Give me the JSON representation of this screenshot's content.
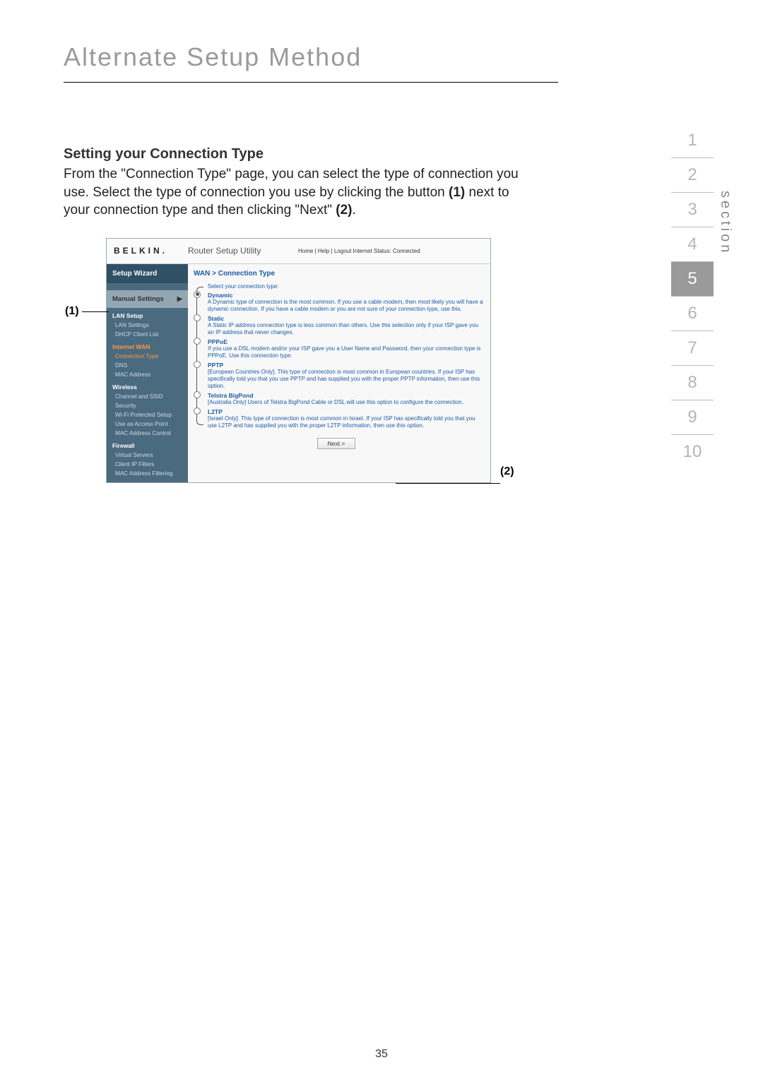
{
  "page_title": "Alternate Setup Method",
  "section_heading": "Setting your Connection Type",
  "body_paragraph_parts": {
    "p1": "From the \"Connection Type\" page, you can select the type of connection you use. Select the type of connection you use by clicking the button ",
    "b1": "(1)",
    "p2": " next to your connection type and then clicking \"Next\" ",
    "b2": "(2)",
    "p3": "."
  },
  "callouts": {
    "one": "(1)",
    "two": "(2)"
  },
  "section_nav": {
    "label": "section",
    "numbers": [
      "1",
      "2",
      "3",
      "4",
      "5",
      "6",
      "7",
      "8",
      "9",
      "10"
    ],
    "current": "5"
  },
  "router": {
    "logo": "BELKIN.",
    "title": "Router Setup Utility",
    "links": "Home | Help | Logout   Internet Status: Connected",
    "sidebar": {
      "wizard": "Setup Wizard",
      "manual": "Manual Settings",
      "groups": [
        {
          "name": "LAN Setup",
          "items": [
            "LAN Settings",
            "DHCP Client List"
          ]
        },
        {
          "name": "Internet WAN",
          "orange": true,
          "items_styled": [
            {
              "text": "Connection Type",
              "orange": true
            },
            {
              "text": "DNS"
            },
            {
              "text": "MAC Address"
            }
          ]
        },
        {
          "name": "Wireless",
          "items": [
            "Channel and SSID",
            "Security",
            "Wi-Fi Protected Setup",
            "Use as Access Point",
            "MAC Address Control"
          ]
        },
        {
          "name": "Firewall",
          "items": [
            "Virtual Servers",
            "Client IP Filters",
            "MAC Address Filtering"
          ]
        }
      ]
    },
    "main": {
      "breadcrumb": "WAN > Connection Type",
      "select_header": "Select your connection type:",
      "options": [
        {
          "name": "Dynamic",
          "selected": true,
          "desc": "A Dynamic type of connection is the most common. If you use a cable modem, then most likely you will have a dynamic connection. If you have a cable modem or you are not sure of your connection type, use this."
        },
        {
          "name": "Static",
          "desc": "A Static IP address connection type is less common than others. Use this selection only if your ISP gave you an IP address that never changes."
        },
        {
          "name": "PPPoE",
          "desc": "If you use a DSL modem and/or your ISP gave you a User Name and Password, then your connection type is PPPoE. Use this connection type."
        },
        {
          "name": "PPTP",
          "desc": "[European Countries Only]. This type of connection is most common in European countries. If your ISP has specifically told you that you use PPTP and has supplied you with the proper PPTP information, then use this option."
        },
        {
          "name": "Telstra BigPond",
          "desc": "[Australia Only] Users of Telstra BigPond Cable or DSL will use this option to configure the connection."
        },
        {
          "name": "L2TP",
          "desc": "[Israel Only]. This type of connection is most common in Israel. If your ISP has specifically told you that you use L2TP and has supplied you with the proper L2TP information, then use this option."
        }
      ],
      "next": "Next >"
    }
  },
  "page_number": "35"
}
